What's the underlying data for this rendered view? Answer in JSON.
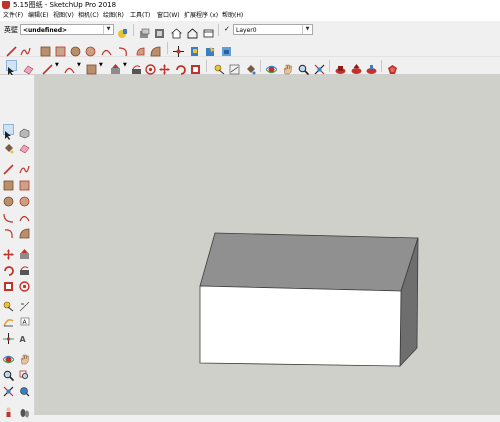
{
  "window": {
    "title": "5.15图纸 - SketchUp Pro 2018"
  },
  "menu": {
    "items": [
      "文件(F)",
      "编辑(E)",
      "视图(V)",
      "相机(C)",
      "绘图(R)",
      "工具(T)",
      "窗口(W)",
      "扩展程序 (x)",
      "帮助(H)"
    ]
  },
  "toolbar": {
    "style_label": "英壁",
    "style_combo_value": "<undefined>",
    "layer_check": "✓",
    "layer_combo_value": "Layer0"
  },
  "colors": {
    "canvas_bg": "#d0d0cb",
    "box_front": "#ffffff",
    "box_top": "#909090",
    "box_side": "#6e6e6e",
    "accent_red": "#c0322a"
  }
}
